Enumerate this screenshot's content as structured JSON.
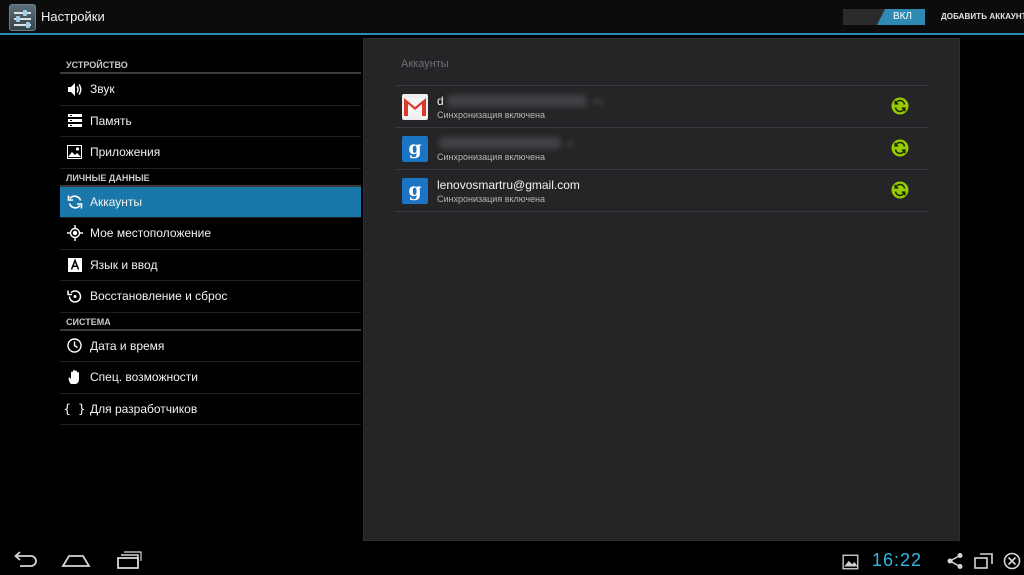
{
  "actionbar": {
    "title": "Настройки",
    "toggle_label": "ВКЛ",
    "add_account_label": "ДОБАВИТЬ АККАУНТ"
  },
  "nav": {
    "sections": [
      {
        "header": "УСТРОЙСТВО",
        "items": [
          {
            "label": "Звук",
            "icon": "sound-icon"
          },
          {
            "label": "Память",
            "icon": "storage-icon"
          },
          {
            "label": "Приложения",
            "icon": "apps-icon"
          }
        ]
      },
      {
        "header": "ЛИЧНЫЕ ДАННЫЕ",
        "items": [
          {
            "label": "Аккаунты",
            "icon": "sync-icon",
            "selected": true
          },
          {
            "label": "Мое местоположение",
            "icon": "location-icon"
          },
          {
            "label": "Язык и ввод",
            "icon": "language-icon"
          },
          {
            "label": "Восстановление и сброс",
            "icon": "backup-icon"
          }
        ]
      },
      {
        "header": "СИСТЕМА",
        "items": [
          {
            "label": "Дата и время",
            "icon": "clock-icon"
          },
          {
            "label": "Спец. возможности",
            "icon": "accessibility-icon"
          },
          {
            "label": "Для разработчиков",
            "icon": "braces-icon"
          }
        ]
      }
    ]
  },
  "panel": {
    "title": "Аккаунты",
    "accounts": [
      {
        "name": "d",
        "name_tail": "ru",
        "type": "gmail",
        "status": "Синхронизация включена",
        "blurred": true
      },
      {
        "name": "",
        "name_tail": "n",
        "type": "google",
        "status": "Синхронизация включена",
        "blurred": true
      },
      {
        "name": "lenovosmartru@gmail.com",
        "type": "google",
        "status": "Синхронизация включена",
        "blurred": false
      }
    ]
  },
  "sysbar": {
    "clock": "16:22"
  },
  "colors": {
    "accent": "#33b5e5",
    "selected": "#1a77a9",
    "sync_green": "#99cc00"
  }
}
